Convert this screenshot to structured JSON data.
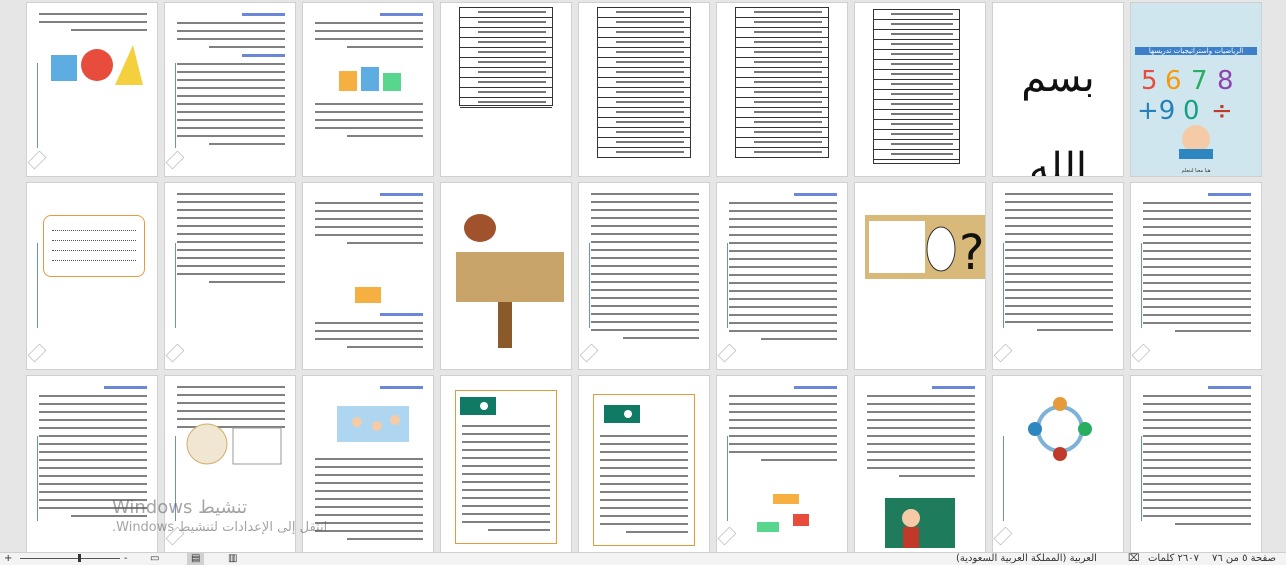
{
  "status_bar": {
    "page_info": "صفحة ٥ من ٧٦",
    "word_count": "٢٦٠٧ كلمات",
    "language": "العربية (المملكة العربية السعودية)",
    "zoom_plus": "+",
    "zoom_minus": "-"
  },
  "watermark": {
    "line1": "تنشيط Windows",
    "line2": "انتقل إلى الإعدادات لتنشيط Windows."
  },
  "cover": {
    "title": "الرياضيات واستراتيجيات تدريسها",
    "footer": "هيا معنا لنتعلم"
  },
  "bismillah_text": "بسم الله الرحمن الرحيم",
  "colors": {
    "canvas_bg": "#e6e6e6",
    "accent_blue": "#3a5fcd",
    "orange_border": "#e59a3c"
  }
}
